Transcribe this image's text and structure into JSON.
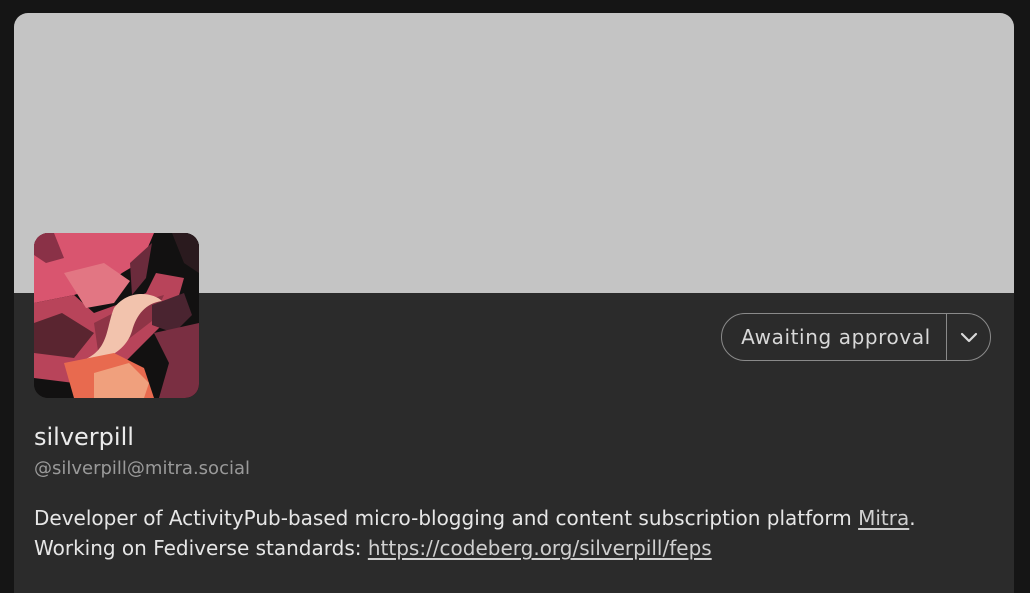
{
  "profile": {
    "display_name": "silverpill",
    "handle": "@silverpill@mitra.social",
    "bio": {
      "line1_text": "Developer of ActivityPub-based micro-blogging and content subscription platform ",
      "line1_link": "Mitra",
      "line1_suffix": ".",
      "line2_text": "Working on Fediverse standards: ",
      "line2_link": "https://codeberg.org/silverpill/feps"
    }
  },
  "actions": {
    "follow_status_label": "Awaiting approval",
    "dropdown_icon": "chevron-down-icon"
  },
  "colors": {
    "page_background": "#151515",
    "card_background": "#2b2b2b",
    "banner": "#c4c4c4"
  }
}
